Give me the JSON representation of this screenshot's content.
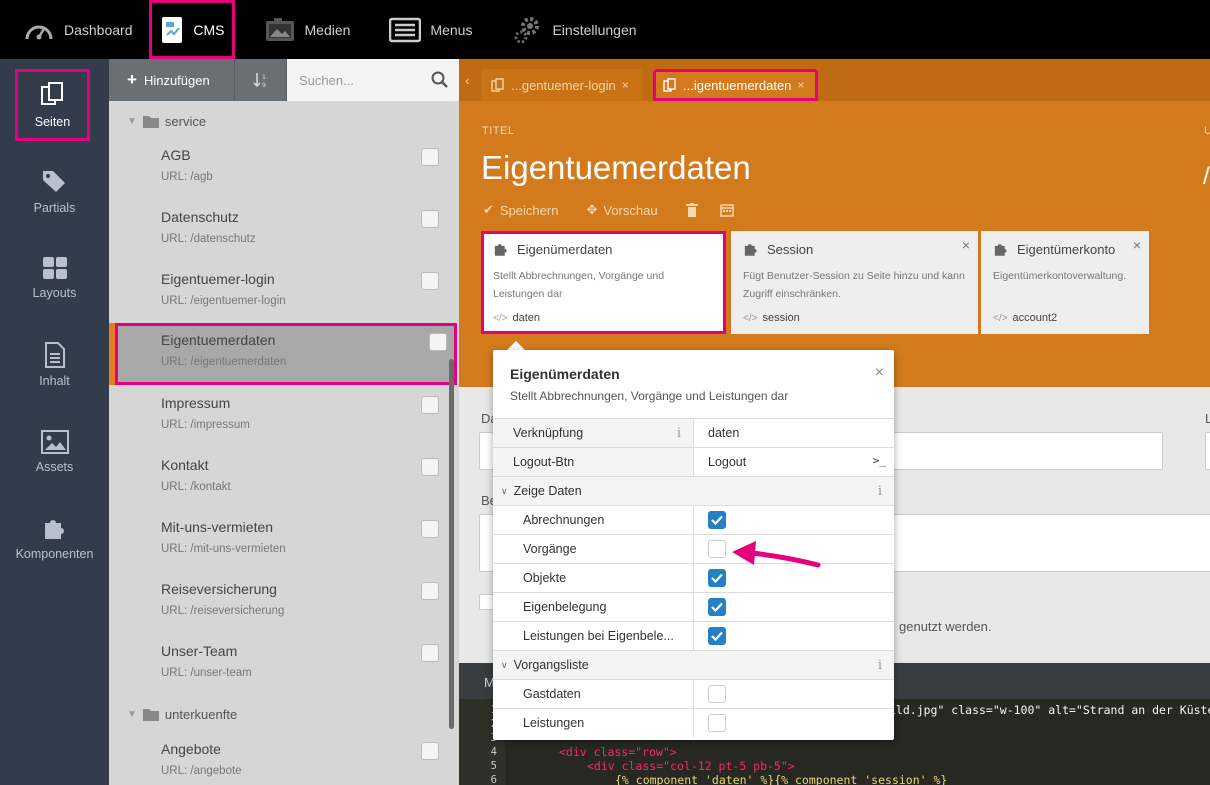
{
  "topnav": {
    "items": [
      {
        "label": "Dashboard",
        "icon": "dashboard-icon"
      },
      {
        "label": "CMS",
        "icon": "cms-icon"
      },
      {
        "label": "Medien",
        "icon": "media-icon"
      },
      {
        "label": "Menus",
        "icon": "menus-icon"
      },
      {
        "label": "Einstellungen",
        "icon": "settings-icon"
      }
    ],
    "active": "CMS"
  },
  "sidebar": {
    "items": [
      {
        "label": "Seiten",
        "icon": "pages-icon"
      },
      {
        "label": "Partials",
        "icon": "tags-icon"
      },
      {
        "label": "Layouts",
        "icon": "layouts-icon"
      },
      {
        "label": "Inhalt",
        "icon": "content-icon"
      },
      {
        "label": "Assets",
        "icon": "image-icon"
      },
      {
        "label": "Komponenten",
        "icon": "puzzle-icon"
      }
    ],
    "active": "Seiten"
  },
  "list": {
    "add_label": "Hinzufügen",
    "search_placeholder": "Suchen...",
    "folders": [
      "service",
      "unterkuenfte"
    ],
    "pages": [
      {
        "title": "AGB",
        "url": "URL: /agb"
      },
      {
        "title": "Datenschutz",
        "url": "URL: /datenschutz"
      },
      {
        "title": "Eigentuemer-login",
        "url": "URL: /eigentuemer-login"
      },
      {
        "title": "Eigentuemerdaten",
        "url": "URL: /eigentuemerdaten"
      },
      {
        "title": "Impressum",
        "url": "URL: /impressum"
      },
      {
        "title": "Kontakt",
        "url": "URL: /kontakt"
      },
      {
        "title": "Mit-uns-vermieten",
        "url": "URL: /mit-uns-vermieten"
      },
      {
        "title": "Reiseversicherung",
        "url": "URL: /reiseversicherung"
      },
      {
        "title": "Unser-Team",
        "url": "URL: /unser-team"
      },
      {
        "title": "Angebote",
        "url": "URL: /angebote"
      }
    ],
    "selected": "Eigentuemerdaten"
  },
  "tabs": [
    {
      "label": "...gentuemer-login",
      "close": "×"
    },
    {
      "label": "...igentuemerdaten",
      "close": "×"
    }
  ],
  "editor": {
    "title_label": "TITEL",
    "title": "Eigentuemerdaten",
    "cut_label": "U",
    "cut_value": "/",
    "actions": {
      "save": "Speichern",
      "preview": "Vorschau"
    }
  },
  "components": [
    {
      "name": "Eigenümerdaten",
      "desc": "Stellt Abbrechnungen, Vorgänge und Leistungen dar",
      "alias": "daten"
    },
    {
      "name": "Session",
      "desc": "Fügt Benutzer-Session zu Seite hinzu und kann Zugriff einschränken.",
      "alias": "session"
    },
    {
      "name": "Eigentümerkonto",
      "desc": "Eigentümerkontoverwaltung.",
      "alias": "account2"
    }
  ],
  "form": {
    "label_da": "Da",
    "label_l": "L",
    "label_be": "Be",
    "usage_text": "genutzt werden.",
    "code_header": "M"
  },
  "code": {
    "line_numbers": [
      "1",
      "2",
      "3",
      "4",
      "5",
      "6"
    ],
    "line1_tail": "ild.jpg\" class=\"w-100\" alt=\"Strand an der Küste",
    "line4": "<div class=\"row\">",
    "line5": "<div class=\"col-12 pt-5 pb-5\">",
    "line6": "{% component 'daten' %}{% component 'session' %}"
  },
  "popup": {
    "title": "Eigenümerdaten",
    "subtitle": "Stellt Abbrechnungen, Vorgänge und Leistungen dar",
    "close": "×",
    "rows": {
      "link_label": "Verknüpfung",
      "link_value": "daten",
      "logout_label": "Logout-Btn",
      "logout_value": "Logout",
      "group1": "Zeige Daten",
      "abrechnungen": "Abrechnungen",
      "vorgaenge": "Vorgänge",
      "objekte": "Objekte",
      "eigenbelegung": "Eigenbelegung",
      "leistungen_eigen": "Leistungen bei Eigenbele...",
      "group2": "Vorgangsliste",
      "gastdaten": "Gastdaten",
      "leistungen": "Leistungen"
    },
    "checked": {
      "abrechnungen": true,
      "vorgaenge": false,
      "objekte": true,
      "eigenbelegung": true,
      "leistungen_eigen": true,
      "gastdaten": false,
      "leistungen": false
    }
  },
  "colors": {
    "accent": "#e6007e",
    "orange": "#d37b1c",
    "checkbox": "#2581c4"
  }
}
